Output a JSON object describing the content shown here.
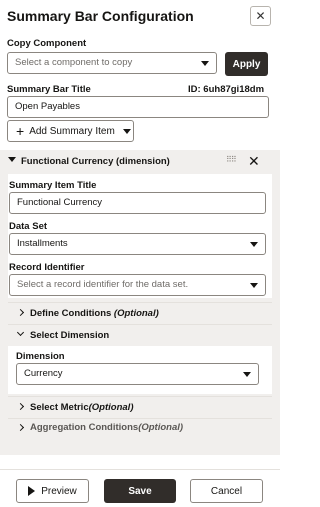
{
  "header": {
    "title": "Summary Bar Configuration",
    "close_glyph": "✕"
  },
  "copy_component": {
    "label": "Copy Component",
    "placeholder": "Select a component to copy",
    "apply_label": "Apply"
  },
  "summary_bar_title": {
    "label": "Summary Bar Title",
    "id_text": "ID: 6uh87gi18dm",
    "value": "Open Payables"
  },
  "add_summary_item": {
    "plus_glyph": "+",
    "label": "Add Summary Item"
  },
  "summary_item": {
    "header": "Functional Currency (dimension)",
    "drag_glyph": "⠿⠿",
    "close_glyph": "✕",
    "title_label": "Summary Item Title",
    "title_value": "Functional Currency",
    "data_set_label": "Data Set",
    "data_set_value": "Installments",
    "record_identifier_label": "Record Identifier",
    "record_identifier_placeholder": "Select a record identifier for the data set.",
    "define_conditions": {
      "label": "Define Conditions",
      "optional": "(Optional)"
    },
    "select_dimension": {
      "label": "Select Dimension",
      "dimension_label": "Dimension",
      "dimension_value": "Currency"
    },
    "select_metric": {
      "label": "Select Metric",
      "optional": "(Optional)"
    },
    "aggregation_conditions": {
      "label": "Aggregation Conditions",
      "optional": "(Optional)"
    }
  },
  "footer": {
    "preview_label": "Preview",
    "save_label": "Save",
    "cancel_label": "Cancel"
  }
}
